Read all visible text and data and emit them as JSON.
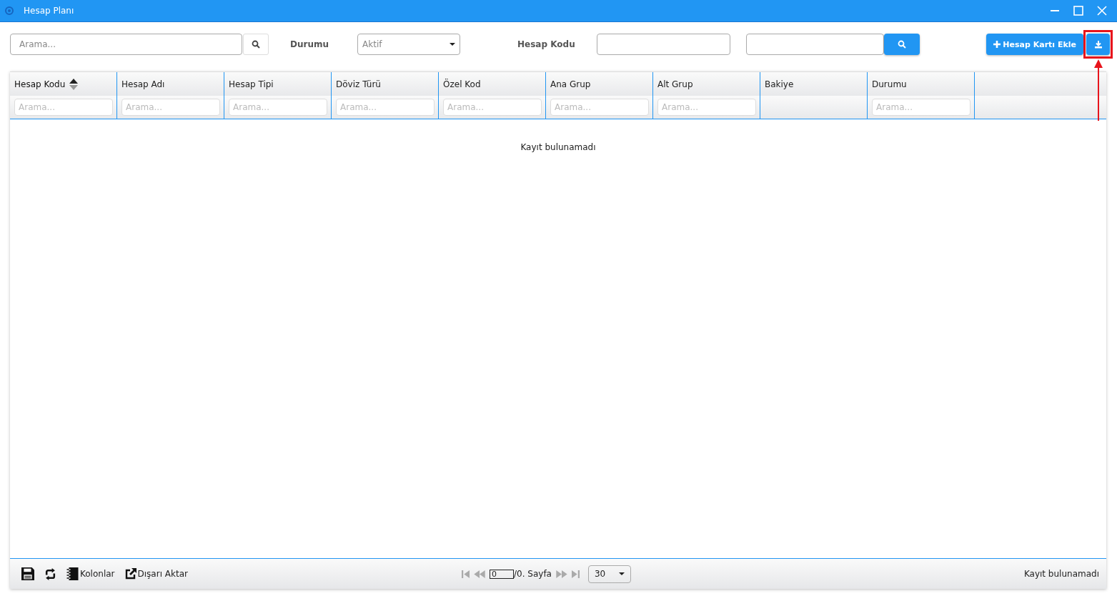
{
  "window": {
    "title": "Hesap Planı"
  },
  "toolbar": {
    "search": {
      "placeholder": "Arama..."
    },
    "status_label": "Durumu",
    "status_select": {
      "value": "Aktif"
    },
    "code_label": "Hesap Kodu",
    "add_button": "Hesap Kartı Ekle"
  },
  "annotation": {
    "kind": "highlight-arrow"
  },
  "table": {
    "columns": [
      {
        "label": "Hesap Kodu",
        "sorted": true,
        "filter": {
          "placeholder": "Arama..."
        }
      },
      {
        "label": "Hesap Adı",
        "sorted": false,
        "filter": {
          "placeholder": "Arama..."
        }
      },
      {
        "label": "Hesap Tipi",
        "sorted": false,
        "filter": {
          "placeholder": "Arama..."
        }
      },
      {
        "label": "Döviz Türü",
        "sorted": false,
        "filter": {
          "placeholder": "Arama..."
        }
      },
      {
        "label": "Özel Kod",
        "sorted": false,
        "filter": {
          "placeholder": "Arama..."
        }
      },
      {
        "label": "Ana Grup",
        "sorted": false,
        "filter": {
          "placeholder": "Arama..."
        }
      },
      {
        "label": "Alt Grup",
        "sorted": false,
        "filter": {
          "placeholder": "Arama..."
        }
      },
      {
        "label": "Bakiye",
        "sorted": false
      },
      {
        "label": "Durumu",
        "sorted": false,
        "filter": {
          "placeholder": "Arama..."
        }
      }
    ],
    "empty_message": "Kayıt bulunamadı"
  },
  "footer": {
    "tools": [
      {
        "kind": "save"
      },
      {
        "kind": "refresh"
      },
      {
        "kind": "columns",
        "label": "Kolonlar"
      },
      {
        "kind": "export",
        "label": "Dışarı Aktar"
      }
    ],
    "pager": {
      "page": "0",
      "page_suffix": "/0. Sayfa",
      "page_size": "30"
    },
    "status": "Kayıt bulunamadı"
  }
}
